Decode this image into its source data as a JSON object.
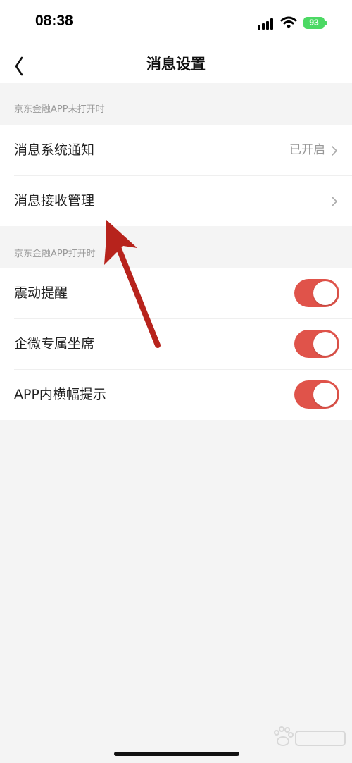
{
  "status": {
    "time": "08:38",
    "battery": "93"
  },
  "nav": {
    "title": "消息设置"
  },
  "sections": [
    {
      "header": "京东金融APP未打开时",
      "rows": [
        {
          "label": "消息系统通知",
          "value": "已开启"
        },
        {
          "label": "消息接收管理"
        }
      ]
    },
    {
      "header": "京东金融APP打开时",
      "rows": [
        {
          "label": "震动提醒",
          "toggle": true
        },
        {
          "label": "企微专属坐席",
          "toggle": true
        },
        {
          "label": "APP内横幅提示",
          "toggle": true
        }
      ]
    }
  ],
  "colors": {
    "toggle_on": "#e0534a",
    "annotation_arrow": "#b7231c",
    "background": "#f4f4f4"
  },
  "icons": [
    "back-chevron-icon",
    "row-chevron-icon",
    "signal-icon",
    "wifi-icon",
    "battery-icon",
    "annotation-arrow",
    "baidu-watermark"
  ]
}
